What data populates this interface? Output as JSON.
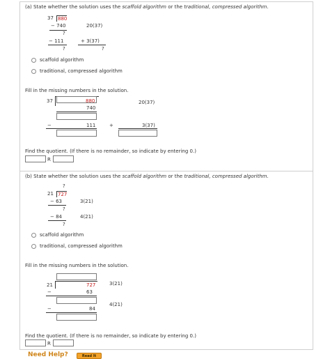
{
  "part_a": {
    "prompt_prefix": "(a) State whether the solution uses the ",
    "option1_italic": "scaffold algorithm",
    "prompt_or": " or the ",
    "option2_italic": "traditional, compressed algorithm",
    "prompt_suffix": ".",
    "example": {
      "divisor": "37",
      "dividend": "880",
      "step1_sub": "− 740",
      "step1_note": "20(37)",
      "q1": "?",
      "step2_sub": "− 111",
      "step2_note": "+ 3(37)",
      "q2": "?",
      "q3": "?"
    },
    "choices": [
      "scaffold algorithm",
      "traditional, compressed algorithm"
    ],
    "fill_prompt": "Fill in the missing numbers in the solution.",
    "fill": {
      "divisor": "37",
      "dividend": "880",
      "sub1": "740",
      "note1": "20(37)",
      "minus": "−",
      "sub2": "111",
      "plus": "+",
      "note2": "3(37)"
    },
    "quotient_prompt": "Find the quotient. (If there is no remainder, so indicate by entering 0.)",
    "r_label": "R"
  },
  "part_b": {
    "prompt_prefix": "(b) State whether the solution uses the ",
    "option1_italic": "scaffold algorithm",
    "prompt_or": " or the ",
    "option2_italic": "traditional, compressed algorithm",
    "prompt_suffix": ".",
    "example": {
      "top_q": "?",
      "divisor": "21",
      "dividend": "727",
      "step1_sub": "− 63",
      "step1_note": "3(21)",
      "q1": "?",
      "step2_sub": "− 84",
      "step2_note": "4(21)",
      "q2": "?"
    },
    "choices": [
      "scaffold algorithm",
      "traditional, compressed algorithm"
    ],
    "fill_prompt": "Fill in the missing numbers in the solution.",
    "fill": {
      "divisor": "21",
      "dividend": "727",
      "sub1": "63",
      "note1": "3(21)",
      "minus": "−",
      "sub2": "84",
      "note2": "4(21)"
    },
    "quotient_prompt": "Find the quotient. (If there is no remainder, so indicate by entering 0.)",
    "r_label": "R"
  },
  "footer": {
    "need_help": "Need Help?",
    "read_it": "Read It"
  }
}
